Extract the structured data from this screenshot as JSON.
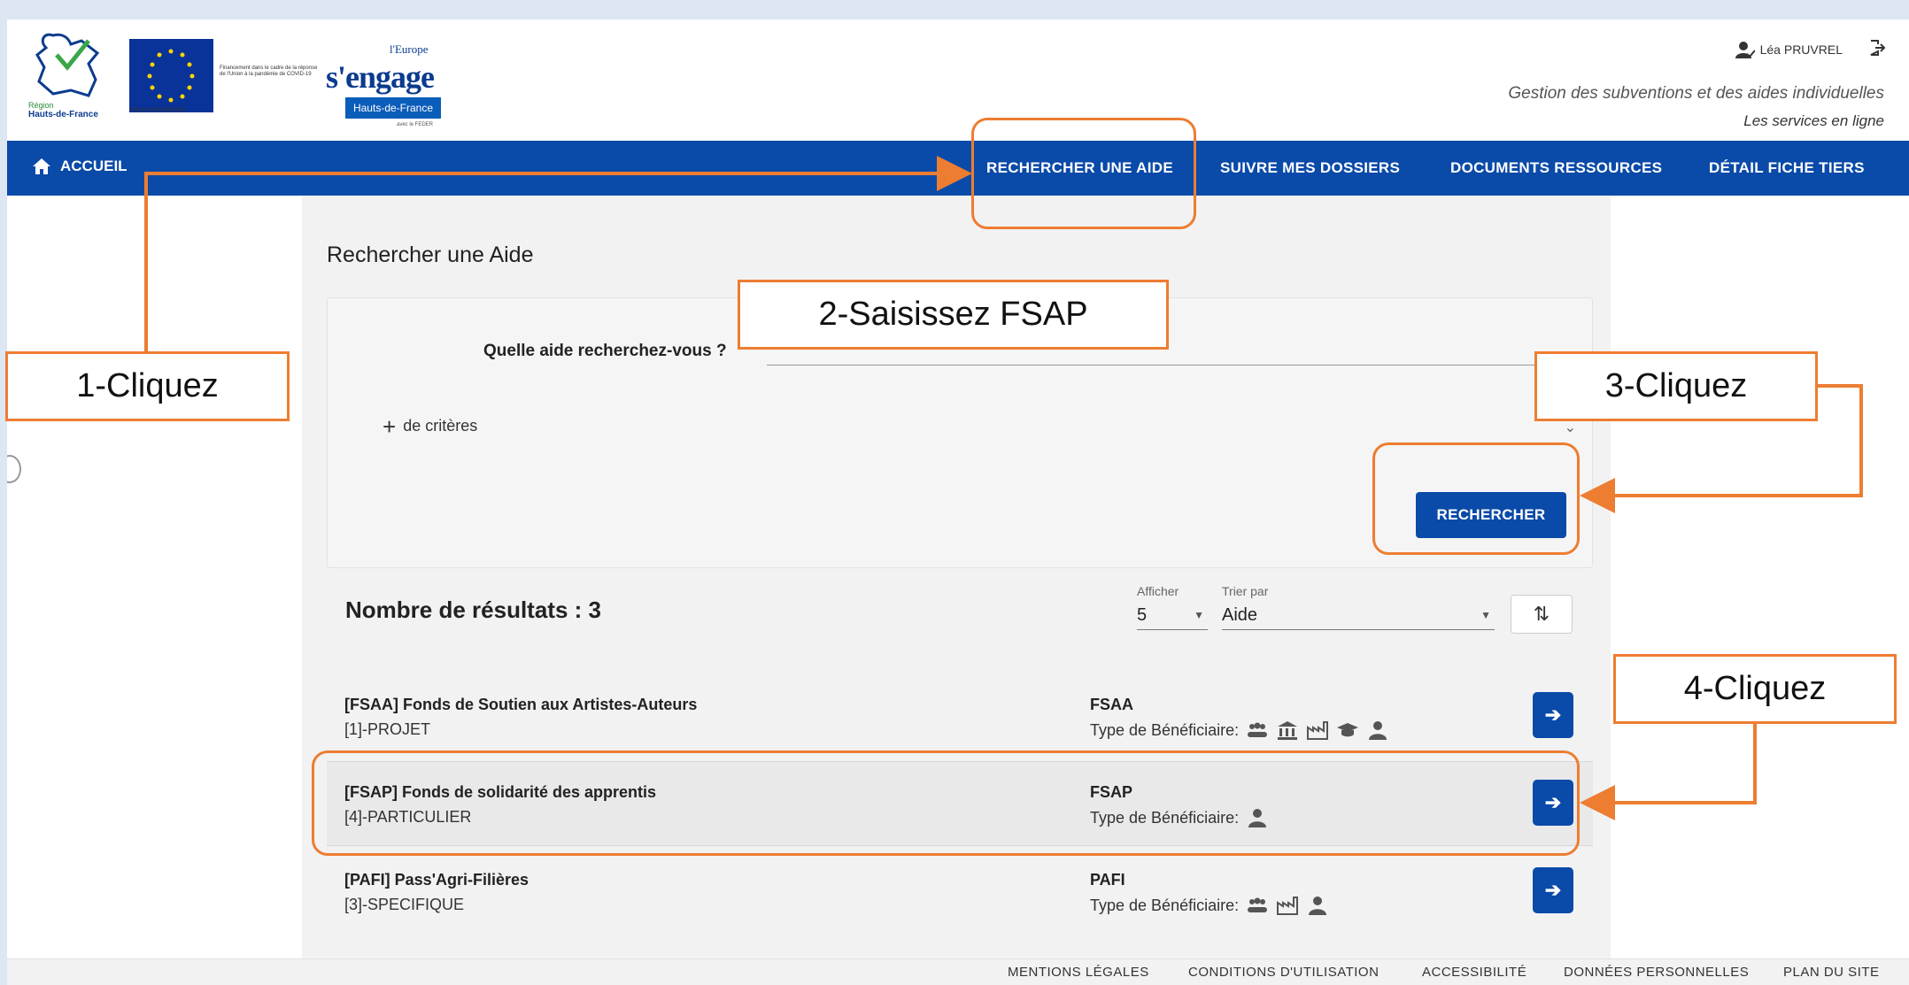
{
  "header": {
    "region_name": "Hauts-de-France",
    "region_small": "Région",
    "eu_text": "Financement dans le cadre de la réponse de l'Union à la pandémie de COVID-19",
    "eu_label": "UNION EUROPÉENNE",
    "engage_top": "l'Europe",
    "engage_big": "s'engage",
    "engage_region": "Hauts-de-France",
    "engage_fund": "avec le FEDER",
    "user_name": "Léa PRUVREL",
    "tagline": "Gestion des subventions et des aides individuelles",
    "tagline2": "Les services en ligne"
  },
  "nav": {
    "home": "ACCUEIL",
    "items": [
      "RECHERCHER UNE AIDE",
      "SUIVRE MES DOSSIERS",
      "DOCUMENTS RESSOURCES",
      "DÉTAIL FICHE TIERS"
    ]
  },
  "search": {
    "title": "Rechercher une Aide",
    "question": "Quelle aide recherchez-vous ?",
    "input_value": "",
    "criteria": "de critères",
    "button": "RECHERCHER"
  },
  "results": {
    "count_label": "Nombre de résultats : 3",
    "show_label": "Afficher",
    "show_value": "5",
    "sort_label": "Trier par",
    "sort_value": "Aide",
    "rows": [
      {
        "name": "[FSAA] Fonds de Soutien aux Artistes-Auteurs",
        "category": "[1]-PROJET",
        "code": "FSAA",
        "type_label": "Type de Bénéficiaire:",
        "icons": [
          "group-icon",
          "institution-icon",
          "factory-icon",
          "graduation-cap-icon",
          "person-icon"
        ]
      },
      {
        "name": "[FSAP] Fonds de solidarité des apprentis",
        "category": "[4]-PARTICULIER",
        "code": "FSAP",
        "type_label": "Type de Bénéficiaire:",
        "icons": [
          "person-icon"
        ]
      },
      {
        "name": "[PAFI] Pass'Agri-Filières",
        "category": "[3]-SPECIFIQUE",
        "code": "PAFI",
        "type_label": "Type de Bénéficiaire:",
        "icons": [
          "group-icon",
          "factory-icon",
          "person-icon"
        ]
      }
    ]
  },
  "footer": [
    "MENTIONS LÉGALES",
    "CONDITIONS D'UTILISATION",
    "ACCESSIBILITÉ",
    "DONNÉES PERSONNELLES",
    "PLAN DU SITE"
  ],
  "annotations": {
    "step1": "1-Cliquez",
    "step2": "2-Saisissez FSAP",
    "step3": "3-Cliquez",
    "step4": "4-Cliquez"
  },
  "colors": {
    "primary": "#0a4aa8",
    "annotation": "#ed7d31"
  }
}
